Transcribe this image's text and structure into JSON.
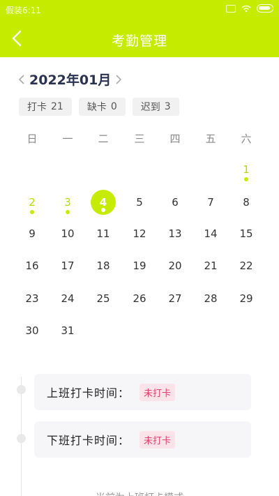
{
  "status_bar": {
    "time": "假装6:11"
  },
  "header": {
    "title": "考勤管理"
  },
  "calendar": {
    "month_label": "2022年01月",
    "stats": [
      {
        "label": "打卡",
        "value": "21"
      },
      {
        "label": "缺卡",
        "value": "0"
      },
      {
        "label": "迟到",
        "value": "3"
      }
    ],
    "weekdays": [
      "日",
      "一",
      "二",
      "三",
      "四",
      "五",
      "六"
    ],
    "days": [
      "1",
      "2",
      "3",
      "4",
      "5",
      "6",
      "7",
      "8",
      "9",
      "10",
      "11",
      "12",
      "13",
      "14",
      "15",
      "16",
      "17",
      "18",
      "19",
      "20",
      "21",
      "22",
      "23",
      "24",
      "25",
      "26",
      "27",
      "28",
      "29",
      "30",
      "31"
    ],
    "first_weekday_index": 6,
    "selected_day": "4",
    "checked_days": [
      "1",
      "2",
      "3"
    ]
  },
  "punch": {
    "morning_label": "上班打卡时间：",
    "morning_status": "未打卡",
    "evening_label": "下班打卡时间：",
    "evening_status": "未打卡"
  },
  "footer": {
    "text": "当前为上班打卡模式"
  },
  "colors": {
    "accent": "#c5ec00",
    "badge_text": "#e0406a",
    "badge_bg": "#fbe3ea"
  }
}
